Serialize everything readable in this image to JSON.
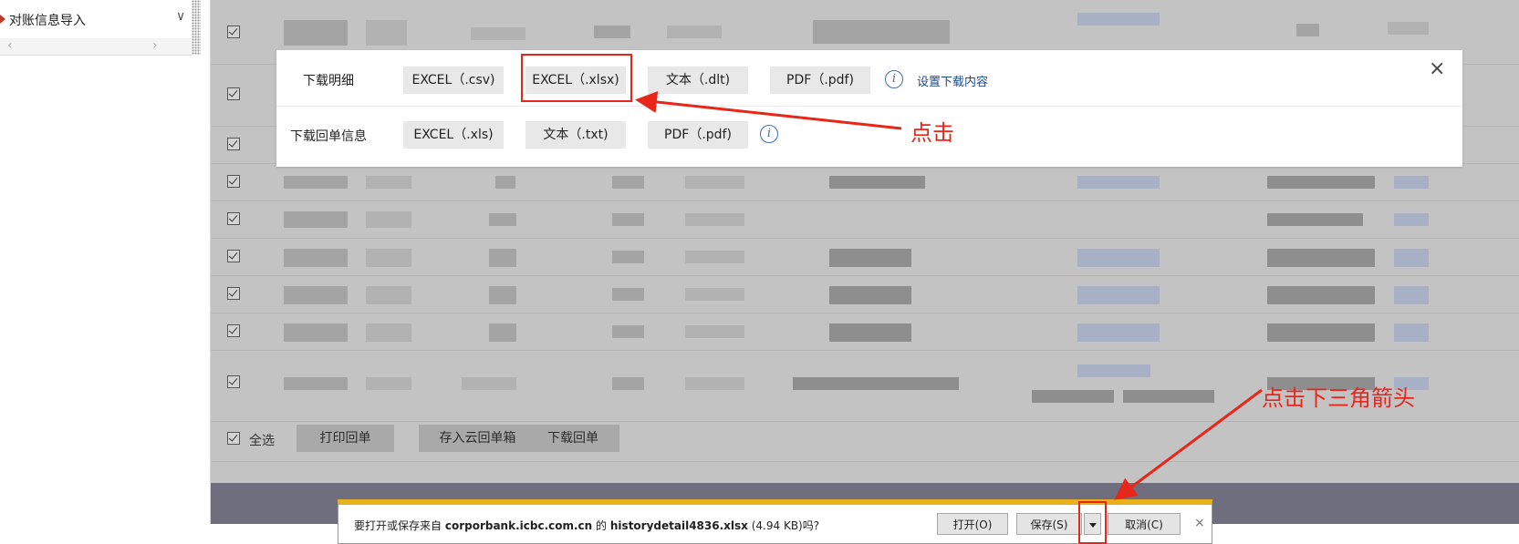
{
  "sidebar": {
    "menu_item": "对账信息导入"
  },
  "table": {
    "select_all_label": "全选",
    "buttons": {
      "print_receipt": "打印回单",
      "save_cloud": "存入云回单箱",
      "download_receipt": "下载回单"
    }
  },
  "download_panel": {
    "detail_label": "下载明细",
    "detail_buttons": [
      "EXCEL（.csv)",
      "EXCEL（.xlsx)",
      "文本（.dlt)",
      "PDF（.pdf)"
    ],
    "settings_link": "设置下载内容",
    "receipt_label": "下载回单信息",
    "receipt_buttons": [
      "EXCEL（.xls)",
      "文本（.txt)",
      "PDF（.pdf)"
    ],
    "info_glyph": "i",
    "close_glyph": "×"
  },
  "download_bar": {
    "msg_prefix": "要打开或保存来自",
    "domain": "corporbank.icbc.com.cn",
    "msg_mid": "的",
    "filename": "historydetail4836.xlsx",
    "size": "(4.94 KB)",
    "msg_suffix": "吗?",
    "open_label": "打开(O)",
    "save_label": "保存(S)",
    "cancel_label": "取消(C)",
    "close_glyph": "×"
  },
  "annotations": {
    "click": "点击",
    "click_triangle": "点击下三角箭头",
    "color": "#e8261a"
  },
  "icons": {
    "info": "info-icon",
    "close": "close-icon",
    "dropdown": "triangle-down-icon",
    "chevron": "chevron-down-icon"
  }
}
